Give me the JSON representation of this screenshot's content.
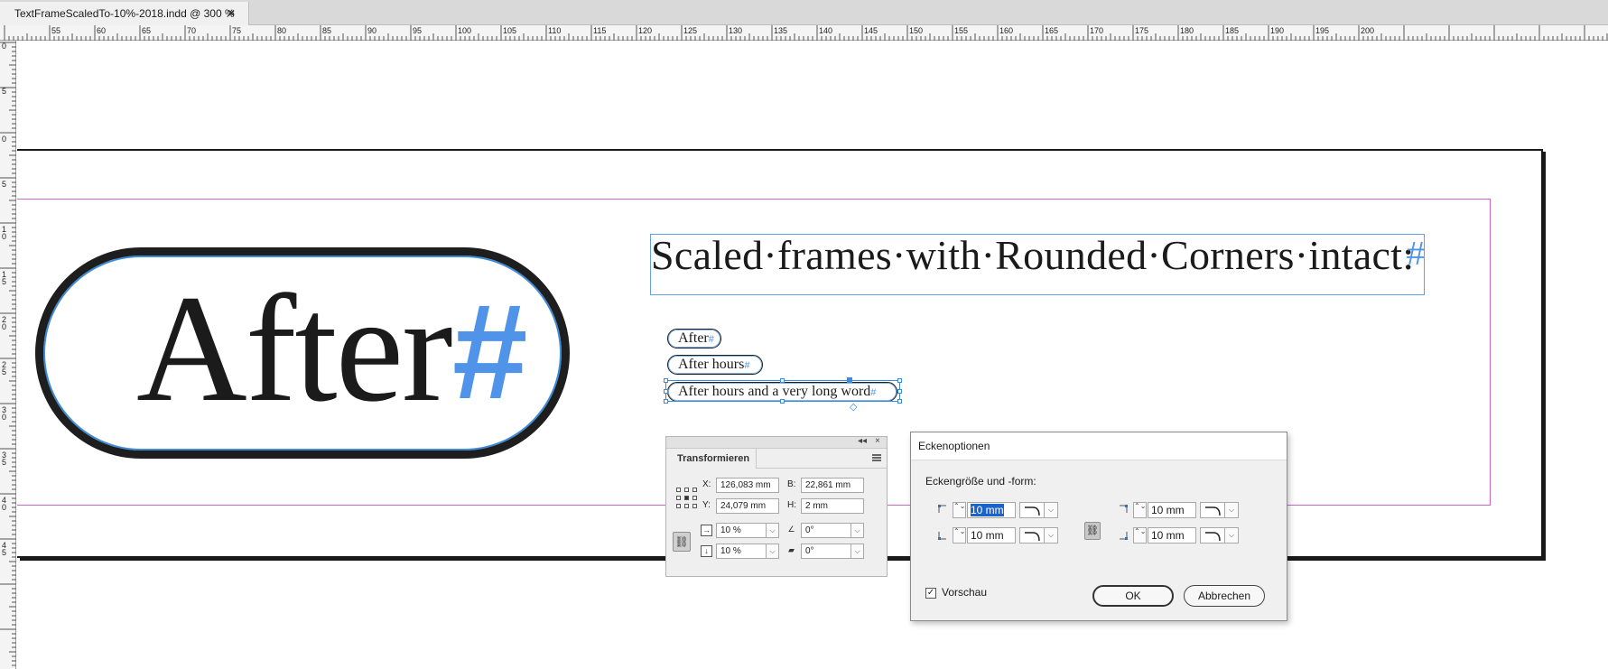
{
  "tabs": [
    {
      "title": "TextFrameScaledTo-10%-2018.indd @ 300 %",
      "close": "×"
    }
  ],
  "ruler": {
    "h_labels": [
      "55",
      "60",
      "65",
      "70",
      "75",
      "80",
      "85",
      "90",
      "95",
      "100",
      "105",
      "110",
      "115",
      "120",
      "125",
      "130",
      "135",
      "140",
      "145",
      "150",
      "155",
      "160",
      "165",
      "170",
      "175",
      "180",
      "185",
      "190",
      "195",
      "200"
    ],
    "v_labels": [
      "0",
      "5",
      "0",
      "5",
      "1 0",
      "1 5",
      "2 0",
      "2 5",
      "3 0",
      "3 5",
      "4 0",
      "4 5"
    ]
  },
  "canvas": {
    "big_pill": {
      "text": "After",
      "hash": "#"
    },
    "heading": {
      "text": "Scaled·frames·with·Rounded·Corners·intact:",
      "hash": "#"
    },
    "pills": [
      {
        "text": "After",
        "hash": "#"
      },
      {
        "text": "After hours",
        "hash": "#"
      },
      {
        "text": "After hours and a very long word",
        "hash": "#"
      }
    ],
    "corner_marker": "◇"
  },
  "transform_panel": {
    "collapse": "◂◂",
    "close": "×",
    "tab": "Transformieren",
    "x_label": "X:",
    "x_value": "126,083 mm",
    "y_label": "Y:",
    "y_value": "24,079 mm",
    "b_label": "B:",
    "b_value": "22,861 mm",
    "h_label": "H:",
    "h_value": "2 mm",
    "scale_x": "10 %",
    "scale_y": "10 %",
    "rotate": "0°",
    "shear": "0°",
    "chain": "⛓",
    "dropdown": "⌵"
  },
  "corner_dialog": {
    "title": "Eckenoptionen",
    "section": "Eckengröße und -form:",
    "top_left": "10 mm",
    "top_right": "10 mm",
    "bottom_left": "10 mm",
    "bottom_right": "10 mm",
    "spin": "⌃⌄",
    "dropdown": "⌵",
    "chain": "⛓",
    "preview_check": "✓",
    "preview_label": "Vorschau",
    "ok": "OK",
    "cancel": "Abbrechen"
  },
  "colors": {
    "accent": "#4f94e8",
    "margin_guide": "#cc66cc",
    "selection": "#3b8bd9"
  }
}
